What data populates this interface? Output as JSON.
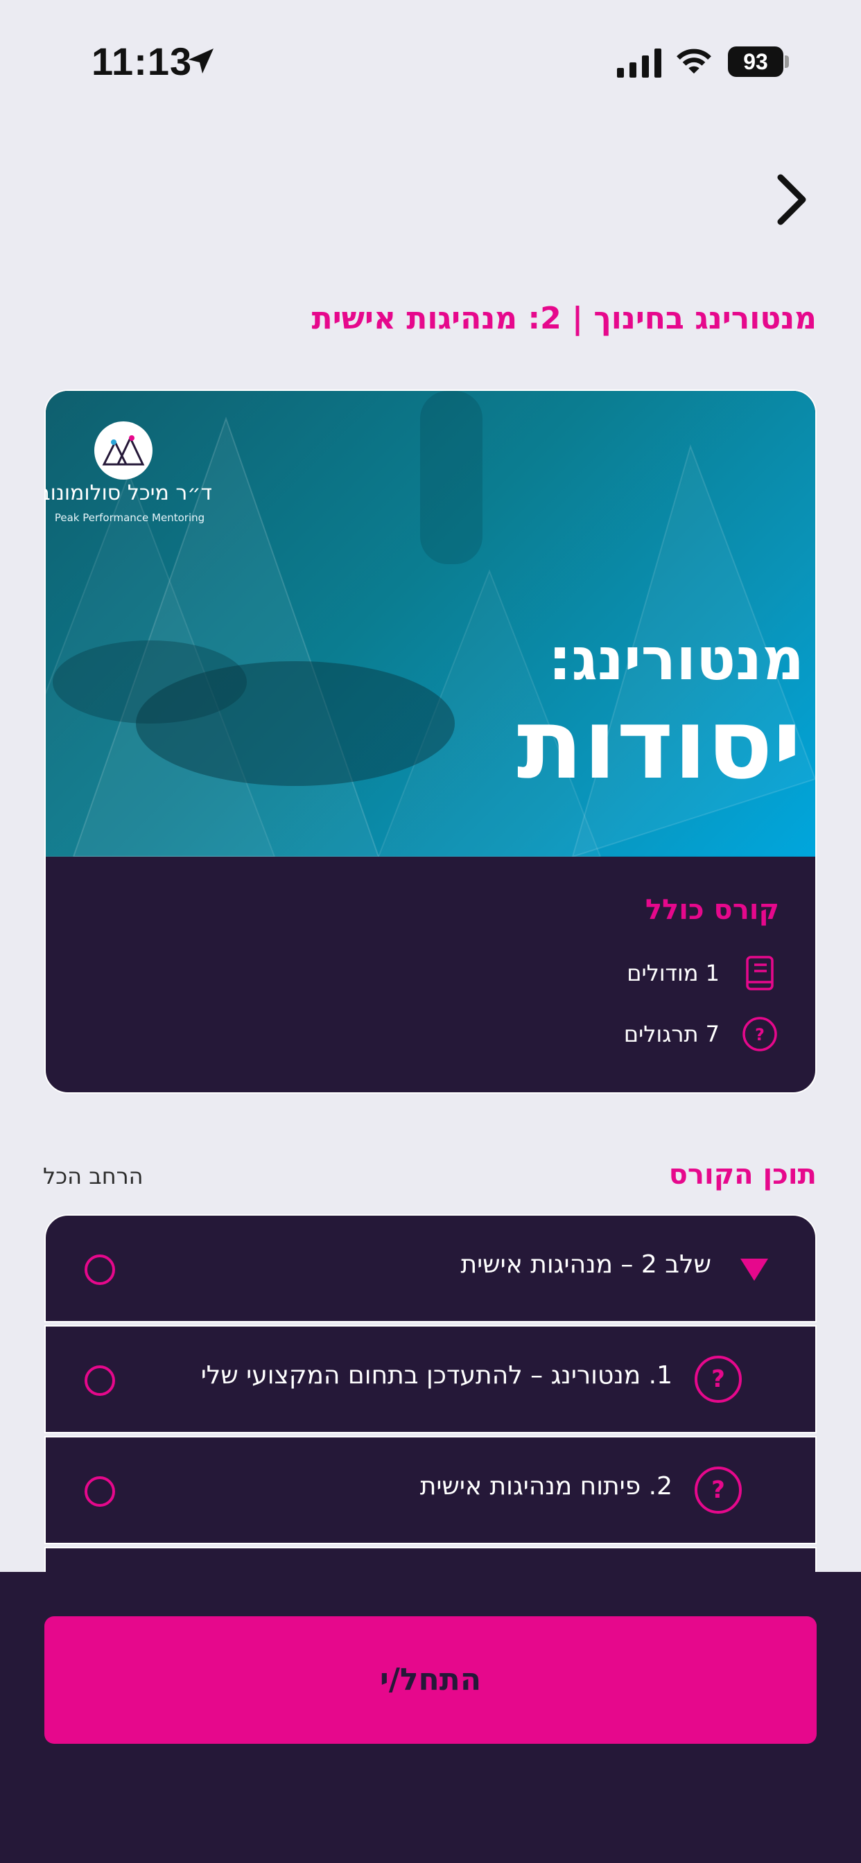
{
  "status_bar": {
    "time": "11:13",
    "battery": "93"
  },
  "header": {
    "title": "מנטורינג בחינוך | 2: מנהיגות אישית"
  },
  "course_card": {
    "logo_name": "ד״ר מיכל סולומונוביץ",
    "logo_tagline": "Peak Performance Mentoring",
    "hero_line1": "מנטורינג:",
    "hero_line2": "יסודות",
    "course_type": "קורס כולל",
    "stats": [
      {
        "label": "1 מודולים",
        "icon": "book-icon"
      },
      {
        "label": "7 תרגולים",
        "icon": "question-icon"
      }
    ]
  },
  "course_content": {
    "title": "תוכן הקורס",
    "expand_all": "הרחב הכל",
    "items": [
      {
        "label": "שלב 2 – מנהיגות אישית",
        "icon": "triangle-down-icon"
      },
      {
        "label": "1. מנטורינג – להתעדכן בתחום המקצועי שלי",
        "icon": "question-icon"
      },
      {
        "label": "2. פיתוח מנהיגות אישית",
        "icon": "question-icon"
      }
    ]
  },
  "footer": {
    "start_label": "התחל/י"
  },
  "colors": {
    "accent": "#e6088c",
    "dark": "#251838",
    "background": "#ebebf2"
  }
}
